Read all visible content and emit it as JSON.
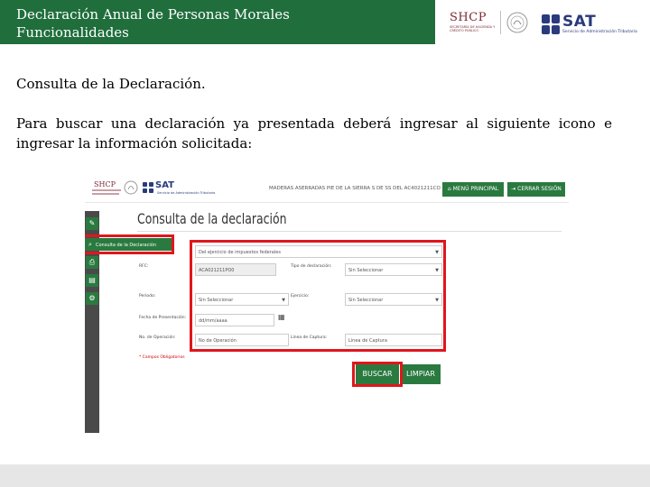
{
  "header": {
    "title_line1": "Declaración Anual de Personas Morales",
    "title_line2": "Funcionalidades",
    "logo_shcp": "SHCP",
    "logo_shcp_sub": "SECRETARÍA DE HACIENDA Y CRÉDITO PÚBLICO",
    "logo_sat": "SAT",
    "logo_sat_sub": "Servicio de Administración Tributaria",
    "brand_green": "#1f6e3c"
  },
  "content": {
    "section_title": "Consulta de la Declaración.",
    "paragraph": "Para buscar una declaración ya presentada deberá ingresar al siguiente icono e ingresar la información solicitada:"
  },
  "screenshot": {
    "shcp": "SHCP",
    "sat": "SAT",
    "sat_sub": "Servicio de Administración Tributaria",
    "company": "MADERAS ASERRADAS PIE DE LA SIERRA S DE SS DEL AC4021211CO",
    "menu_button": "MENÚ PRINCIPAL",
    "close_button": "CERRAR SESIÓN",
    "heading": "Consulta de la declaración",
    "sidebar_item": "Consulta de la Declaración",
    "sidebar_icons": [
      "edit-icon",
      "search-icon",
      "print-icon",
      "document-icon",
      "settings-icon"
    ],
    "form": {
      "impuesto_value": "Del ejercicio de impuestos federales",
      "rfc_label": "RFC:",
      "rfc_value": "ACA021211PO0",
      "tipo_label": "Tipo de declaración:",
      "tipo_value": "Sin Seleccionar",
      "periodo_label": "Periodo:",
      "periodo_value": "Sin Seleccionar",
      "ejercicio_label": "Ejercicio:",
      "ejercicio_value": "Sin Seleccionar",
      "fecha_label": "Fecha de Presentación:",
      "fecha_placeholder": "dd/mm/aaaa",
      "operacion_label": "No. de Operación:",
      "operacion_placeholder": "No de Operación",
      "captura_label": "Línea de Captura:",
      "captura_placeholder": "Línea de Captura",
      "obligatorios_label": "* Campos Obligatorios"
    },
    "buscar_button": "BUSCAR",
    "limpiar_button": "LIMPIAR",
    "highlight_color": "#e0161c"
  }
}
